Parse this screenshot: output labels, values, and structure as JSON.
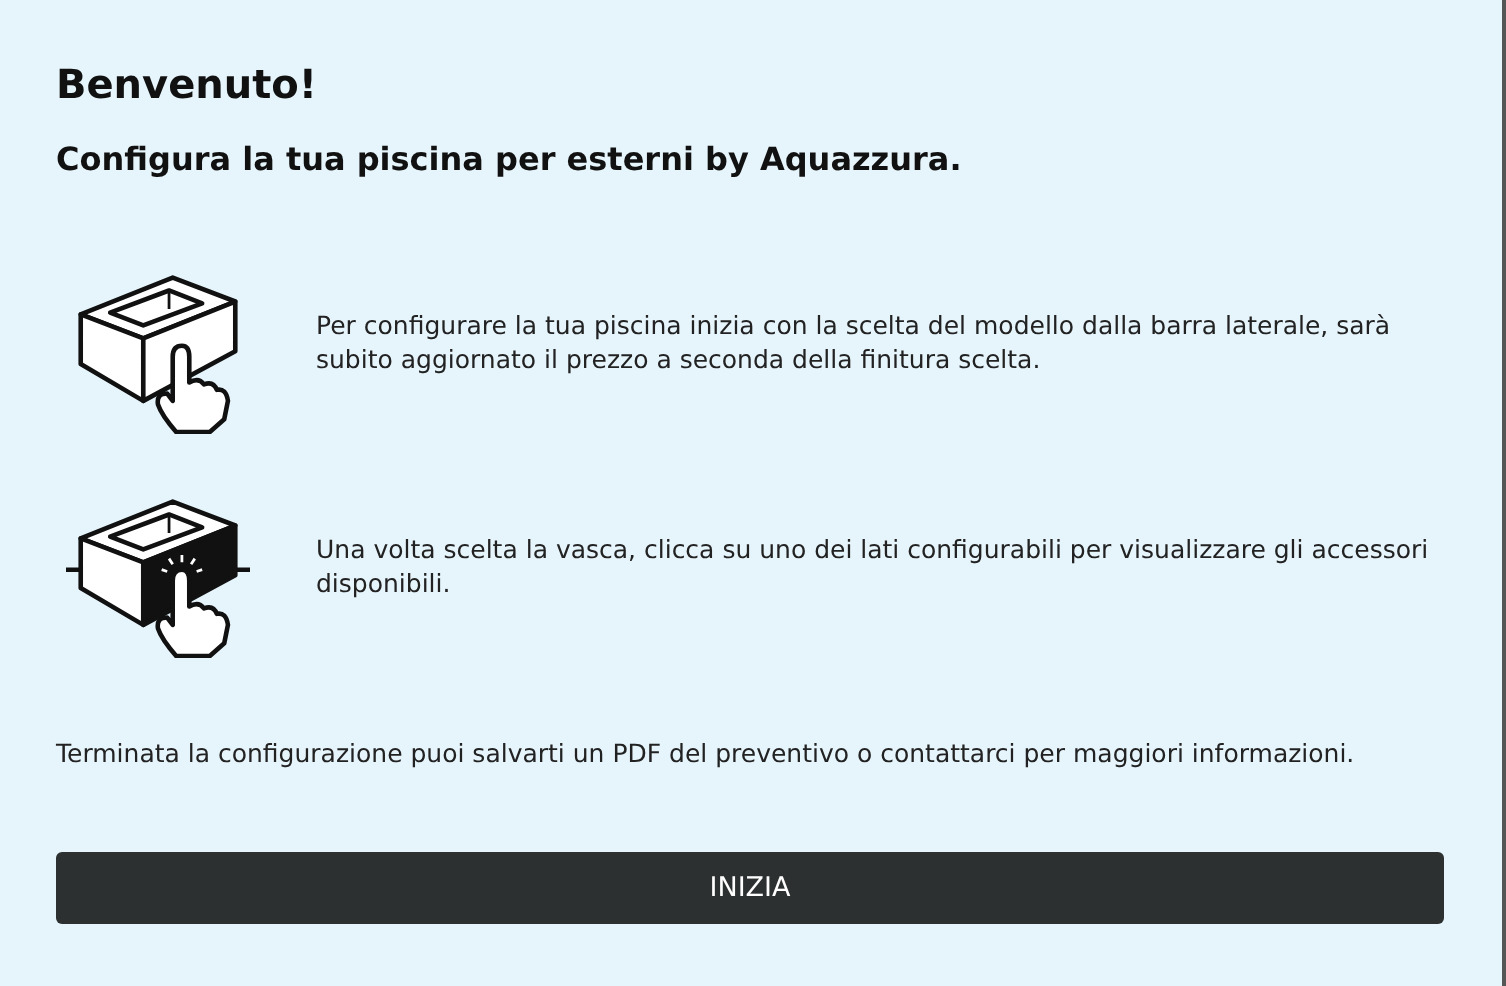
{
  "title": "Benvenuto!",
  "subtitle": "Configura la tua piscina per esterni by Aquazzura.",
  "steps": [
    {
      "kind": "select",
      "text": "Per configurare la tua piscina inizia con la scelta del modello dalla barra laterale, sarà subito aggiornato il prezzo a seconda della finitura scelta."
    },
    {
      "kind": "side",
      "text": "Una volta scelta la vasca, clicca su uno dei lati configurabili per visualizzare gli accessori disponibili."
    }
  ],
  "note": "Terminata la configurazione puoi salvarti un PDF del preventivo o contattarci per maggiori informazioni.",
  "button": "INIZIA"
}
